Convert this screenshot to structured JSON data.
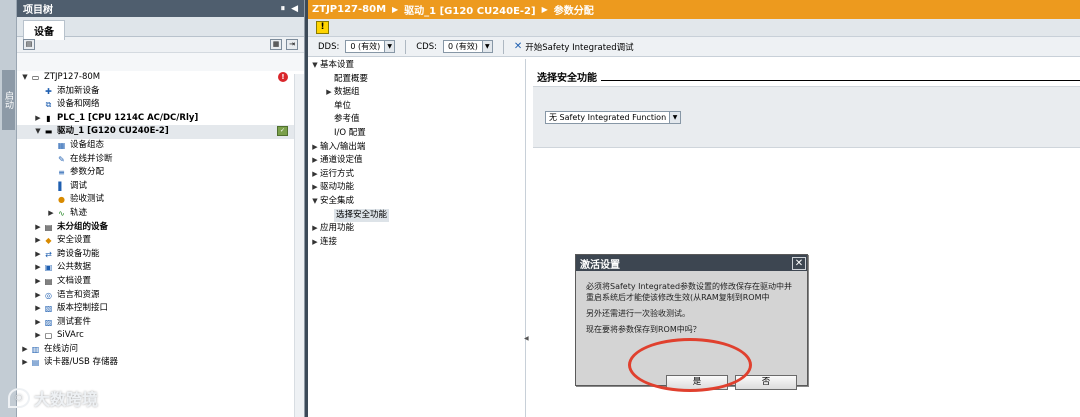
{
  "side_strip": {
    "label": "启动"
  },
  "tree_panel": {
    "title": "项目树",
    "tab": "设备",
    "items": [
      {
        "label": "ZTJP127-80M",
        "icon": "project-icon",
        "arrow": "▼",
        "indent": 0,
        "badge": "error"
      },
      {
        "label": "添加新设备",
        "icon": "add-device-icon",
        "arrow": "",
        "indent": 1
      },
      {
        "label": "设备和网络",
        "icon": "network-icon",
        "arrow": "",
        "indent": 1
      },
      {
        "label": "PLC_1 [CPU 1214C AC/DC/Rly]",
        "icon": "plc-icon",
        "arrow": "▶",
        "indent": 1,
        "bold": true
      },
      {
        "label": "驱动_1 [G120 CU240E-2]",
        "icon": "drive-icon",
        "arrow": "▼",
        "indent": 1,
        "bold": true,
        "selected": true,
        "badge": "ok"
      },
      {
        "label": "设备组态",
        "icon": "device-config-icon",
        "arrow": "",
        "indent": 2
      },
      {
        "label": "在线并诊断",
        "icon": "online-diagnostics-icon",
        "arrow": "",
        "indent": 2
      },
      {
        "label": "参数分配",
        "icon": "parameter-icon",
        "arrow": "",
        "indent": 2
      },
      {
        "label": "调试",
        "icon": "commissioning-icon",
        "arrow": "",
        "indent": 2
      },
      {
        "label": "验收测试",
        "icon": "acceptance-test-icon",
        "arrow": "",
        "indent": 2
      },
      {
        "label": "轨迹",
        "icon": "trace-icon",
        "arrow": "▶",
        "indent": 2
      },
      {
        "label": "未分组的设备",
        "icon": "ungrouped-devices-icon",
        "arrow": "▶",
        "indent": 1,
        "bold": true
      },
      {
        "label": "安全设置",
        "icon": "security-icon",
        "arrow": "▶",
        "indent": 1
      },
      {
        "label": "跨设备功能",
        "icon": "cross-device-icon",
        "arrow": "▶",
        "indent": 1
      },
      {
        "label": "公共数据",
        "icon": "common-data-icon",
        "arrow": "▶",
        "indent": 1
      },
      {
        "label": "文档设置",
        "icon": "document-settings-icon",
        "arrow": "▶",
        "indent": 1
      },
      {
        "label": "语言和资源",
        "icon": "language-icon",
        "arrow": "▶",
        "indent": 1
      },
      {
        "label": "版本控制接口",
        "icon": "version-control-icon",
        "arrow": "▶",
        "indent": 1
      },
      {
        "label": "测试套件",
        "icon": "test-suite-icon",
        "arrow": "▶",
        "indent": 1
      },
      {
        "label": "SiVArc",
        "icon": "sivarc-icon",
        "arrow": "▶",
        "indent": 1
      },
      {
        "label": "在线访问",
        "icon": "online-access-icon",
        "arrow": "▶",
        "indent": 0
      },
      {
        "label": "读卡器/USB 存储器",
        "icon": "card-reader-icon",
        "arrow": "▶",
        "indent": 0
      }
    ]
  },
  "editor": {
    "breadcrumb": [
      "ZTJP127-80M",
      "驱动_1 [G120 CU240E-2]",
      "参数分配"
    ],
    "dds_label": "DDS:",
    "dds_value": "0 (有效)",
    "cds_label": "CDS:",
    "cds_value": "0 (有效)",
    "start_safety_label": "开始Safety Integrated调试",
    "nav": [
      {
        "label": "基本设置",
        "arrow": "▼",
        "indent": 0
      },
      {
        "label": "配置概要",
        "arrow": "",
        "indent": 1
      },
      {
        "label": "数据组",
        "arrow": "▶",
        "indent": 1
      },
      {
        "label": "单位",
        "arrow": "",
        "indent": 1
      },
      {
        "label": "参考值",
        "arrow": "",
        "indent": 1
      },
      {
        "label": "I/O 配置",
        "arrow": "",
        "indent": 1
      },
      {
        "label": "输入/输出端",
        "arrow": "▶",
        "indent": 0
      },
      {
        "label": "通道设定值",
        "arrow": "▶",
        "indent": 0
      },
      {
        "label": "运行方式",
        "arrow": "▶",
        "indent": 0
      },
      {
        "label": "驱动功能",
        "arrow": "▶",
        "indent": 0
      },
      {
        "label": "安全集成",
        "arrow": "▼",
        "indent": 0
      },
      {
        "label": "选择安全功能",
        "arrow": "",
        "indent": 1,
        "selected": true
      },
      {
        "label": "应用功能",
        "arrow": "▶",
        "indent": 0
      },
      {
        "label": "连接",
        "arrow": "▶",
        "indent": 0
      }
    ],
    "section_title": "选择安全功能",
    "function_select_value": "无 Safety Integrated Function"
  },
  "dialog": {
    "title": "激活设置",
    "line1": "必须将Safety Integrated参数设置的修改保存在驱动中并重启系统后才能使该修改生效(从RAM复制到ROM中",
    "line2": "另外还需进行一次验收测试。",
    "line3": "现在要将参数保存到ROM中吗？",
    "yes_label": "是",
    "no_label": "否",
    "close_glyph": "✕"
  },
  "watermark": {
    "text": "大数跨境"
  },
  "colors": {
    "breadcrumb_bg": "#ed9a1e",
    "panel_title_bg": "#4f5e6e",
    "highlight": "#e0402e"
  }
}
